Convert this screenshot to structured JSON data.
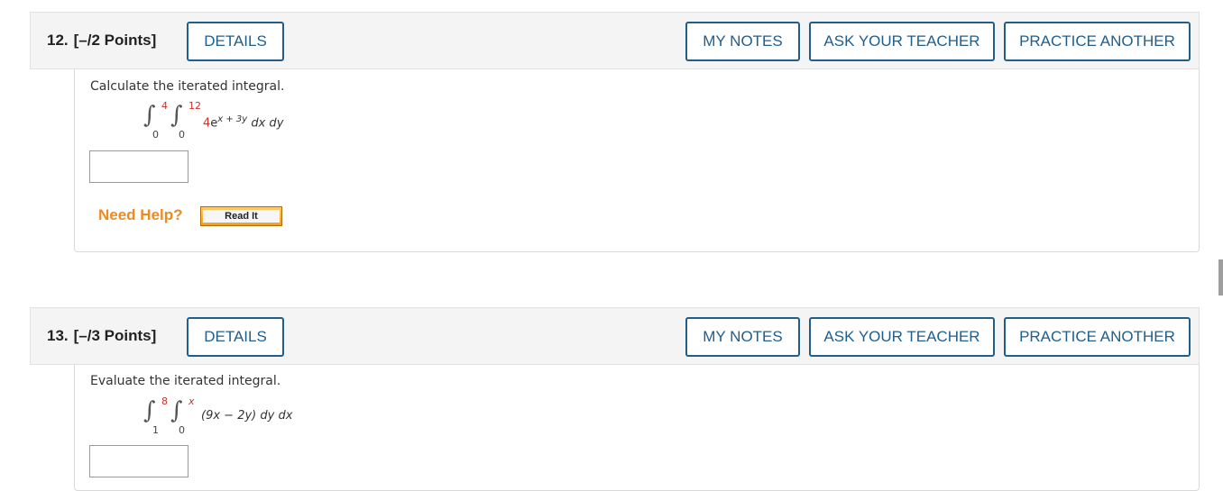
{
  "buttons": {
    "details": "DETAILS",
    "my_notes": "MY NOTES",
    "ask_teacher": "ASK YOUR TEACHER",
    "practice_another": "PRACTICE ANOTHER"
  },
  "q12": {
    "number": "12.",
    "points": "[–/2 Points]",
    "prompt": "Calculate the iterated integral.",
    "outer_upper": "4",
    "outer_lower": "0",
    "inner_upper": "12",
    "inner_lower": "0",
    "coef": "4",
    "base": "e",
    "exponent": "x + 3y",
    "differentials": "dx dy",
    "answer_value": "",
    "need_help": "Need Help?",
    "read_it": "Read It"
  },
  "q13": {
    "number": "13.",
    "points": "[–/3 Points]",
    "prompt": "Evaluate the iterated integral.",
    "outer_upper": "8",
    "outer_lower": "1",
    "inner_upper": "x",
    "inner_lower": "0",
    "integrand": "(9x − 2y) dy dx",
    "answer_value": ""
  },
  "colors": {
    "accent": "#205e8d",
    "help_orange": "#ef8a1c",
    "limit_red": "#d42b2b",
    "header_bg": "#f4f4f4"
  }
}
